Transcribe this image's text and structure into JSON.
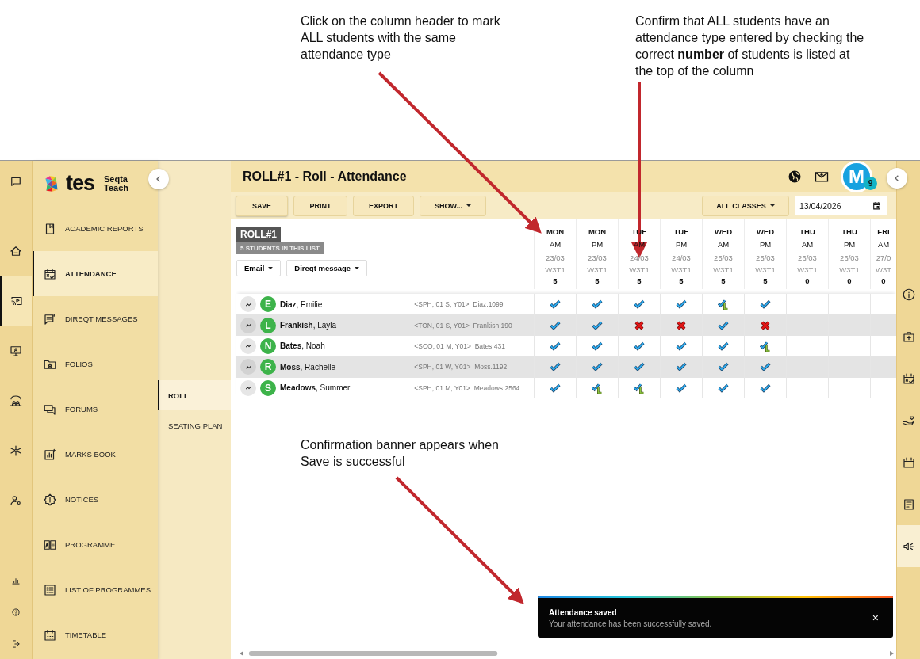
{
  "annotations": [
    {
      "text": "Click on the column header to mark ALL students with the same attendance type"
    },
    {
      "text": "Confirm that ALL students have an attendance type entered by checking the correct **number** of students is listed at the top of the column"
    },
    {
      "text": "Confirmation banner appears when Save is successful"
    }
  ],
  "rail": {
    "items": [
      {
        "selected": false
      },
      {
        "selected": false
      },
      {
        "selected": true
      },
      {
        "selected": false
      },
      {
        "selected": false
      },
      {
        "selected": false
      },
      {
        "selected": false
      },
      {
        "selected": false
      },
      {
        "selected": false
      },
      {
        "selected": false
      }
    ]
  },
  "logo": {
    "wordmark": "tes",
    "product": "Seqta",
    "edition": "Teach"
  },
  "nav": {
    "items": [
      {
        "label": "ACADEMIC REPORTS",
        "selected": false
      },
      {
        "label": "ATTENDANCE",
        "selected": true
      },
      {
        "label": "DIREQT MESSAGES",
        "selected": false
      },
      {
        "label": "FOLIOS",
        "selected": false
      },
      {
        "label": "FORUMS",
        "selected": false
      },
      {
        "label": "MARKS BOOK",
        "selected": false
      },
      {
        "label": "NOTICES",
        "selected": false
      },
      {
        "label": "PROGRAMME",
        "selected": false
      },
      {
        "label": "LIST OF PROGRAMMES",
        "selected": false
      },
      {
        "label": "TIMETABLE",
        "selected": false
      }
    ]
  },
  "subnav": {
    "items": [
      {
        "label": "ROLL",
        "selected": true
      },
      {
        "label": "SEATING PLAN",
        "selected": false
      }
    ]
  },
  "header": {
    "title": "ROLL#1 - Roll - Attendance",
    "avatar": "M",
    "badge": "9"
  },
  "toolbar": {
    "buttons": [
      {
        "label": "SAVE",
        "dropdown": false
      },
      {
        "label": "PRINT",
        "dropdown": false
      },
      {
        "label": "EXPORT",
        "dropdown": false
      },
      {
        "label": "SHOW...",
        "dropdown": true
      }
    ],
    "filter": {
      "label": "ALL CLASSES",
      "dropdown": true
    },
    "date": "13/04/2026"
  },
  "roll": {
    "name": "ROLL#1",
    "count_label": "5 STUDENTS IN THIS LIST",
    "actions": [
      {
        "label": "Email"
      },
      {
        "label": "Direqt message"
      }
    ]
  },
  "columns": [
    {
      "day": "MON",
      "period": "AM",
      "date": "23/03",
      "week": "W3T1",
      "count": "5"
    },
    {
      "day": "MON",
      "period": "PM",
      "date": "23/03",
      "week": "W3T1",
      "count": "5"
    },
    {
      "day": "TUE",
      "period": "AM",
      "date": "24/03",
      "week": "W3T1",
      "count": "5"
    },
    {
      "day": "TUE",
      "period": "PM",
      "date": "24/03",
      "week": "W3T1",
      "count": "5"
    },
    {
      "day": "WED",
      "period": "AM",
      "date": "25/03",
      "week": "W3T1",
      "count": "5"
    },
    {
      "day": "WED",
      "period": "PM",
      "date": "25/03",
      "week": "W3T1",
      "count": "5"
    },
    {
      "day": "THU",
      "period": "AM",
      "date": "26/03",
      "week": "W3T1",
      "count": "0"
    },
    {
      "day": "THU",
      "period": "PM",
      "date": "26/03",
      "week": "W3T1",
      "count": "0"
    },
    {
      "day": "FRI",
      "period": "AM",
      "date": "27/0",
      "week": "W3T",
      "count": "0"
    }
  ],
  "students": [
    {
      "initial": "E",
      "name": "**Diaz**, Emilie",
      "info": "<SPH, 01 S, Y01>",
      "code": "Diaz.1099",
      "marks": [
        {
          "kind": "present"
        },
        {
          "kind": "present"
        },
        {
          "kind": "present"
        },
        {
          "kind": "present"
        },
        {
          "kind": "late"
        },
        {
          "kind": "present"
        }
      ]
    },
    {
      "initial": "L",
      "name": "**Frankish**, Layla",
      "info": "<TON, 01 S, Y01>",
      "code": "Frankish.190",
      "marks": [
        {
          "kind": "present"
        },
        {
          "kind": "present"
        },
        {
          "kind": "absent"
        },
        {
          "kind": "absent"
        },
        {
          "kind": "present"
        },
        {
          "kind": "absent"
        }
      ]
    },
    {
      "initial": "N",
      "name": "**Bates**, Noah",
      "info": "<SCO, 01 M, Y01>",
      "code": "Bates.431",
      "marks": [
        {
          "kind": "present"
        },
        {
          "kind": "present"
        },
        {
          "kind": "present"
        },
        {
          "kind": "present"
        },
        {
          "kind": "present"
        },
        {
          "kind": "late"
        }
      ]
    },
    {
      "initial": "R",
      "name": "**Moss**, Rachelle",
      "info": "<SPH, 01 W, Y01>",
      "code": "Moss.1192",
      "marks": [
        {
          "kind": "present"
        },
        {
          "kind": "present"
        },
        {
          "kind": "present"
        },
        {
          "kind": "present"
        },
        {
          "kind": "present"
        },
        {
          "kind": "present"
        }
      ]
    },
    {
      "initial": "S",
      "name": "**Meadows**, Summer",
      "info": "<SPH, 01 M, Y01>",
      "code": "Meadows.2564",
      "marks": [
        {
          "kind": "present"
        },
        {
          "kind": "late"
        },
        {
          "kind": "late"
        },
        {
          "kind": "present"
        },
        {
          "kind": "present"
        },
        {
          "kind": "present"
        }
      ]
    }
  ],
  "toast": {
    "title": "Attendance saved",
    "message": "Your attendance has been successfully saved.",
    "close": "×"
  },
  "right_rail": {
    "items": [
      {
        "selected": false
      },
      {
        "selected": false
      },
      {
        "selected": false
      },
      {
        "selected": false
      },
      {
        "selected": false
      },
      {
        "selected": false
      },
      {
        "selected": true
      }
    ]
  }
}
